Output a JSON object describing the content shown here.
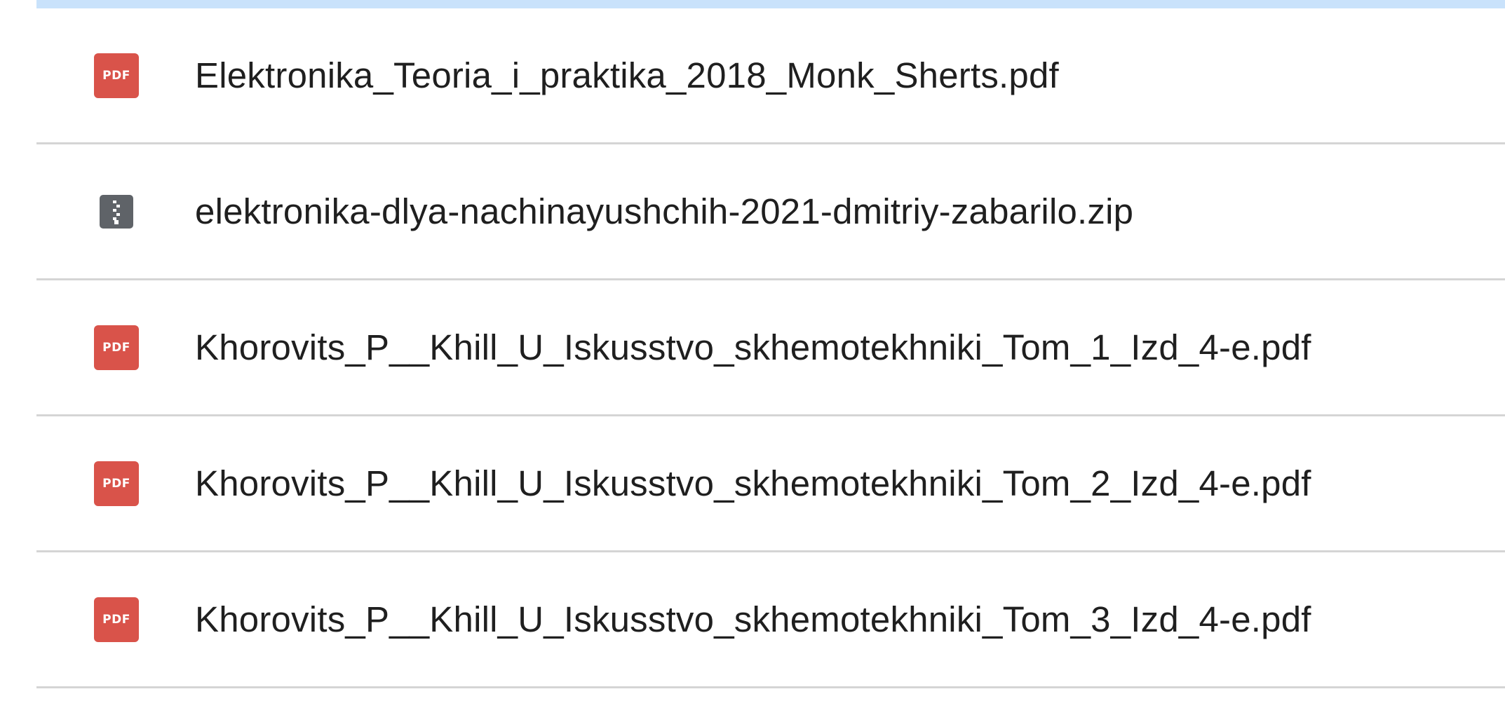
{
  "files": [
    {
      "name": "Elektronika_Teoria_i_praktika_2018_Monk_Sherts.pdf",
      "type_label": "PDF",
      "icon": "pdf-file-icon",
      "icon_color": "#d9534a"
    },
    {
      "name": "elektronika-dlya-nachinayushchih-2021-dmitriy-zabarilo.zip",
      "type_label": "",
      "icon": "zip-archive-icon",
      "icon_color": "#5f6368"
    },
    {
      "name": "Khorovits_P__Khill_U_Iskusstvo_skhemotekhniki_Tom_1_Izd_4-e.pdf",
      "type_label": "PDF",
      "icon": "pdf-file-icon",
      "icon_color": "#d9534a"
    },
    {
      "name": "Khorovits_P__Khill_U_Iskusstvo_skhemotekhniki_Tom_2_Izd_4-e.pdf",
      "type_label": "PDF",
      "icon": "pdf-file-icon",
      "icon_color": "#d9534a"
    },
    {
      "name": "Khorovits_P__Khill_U_Iskusstvo_skhemotekhniki_Tom_3_Izd_4-e.pdf",
      "type_label": "PDF",
      "icon": "pdf-file-icon",
      "icon_color": "#d9534a"
    }
  ],
  "colors": {
    "selected_row_bg": "#c9e2fb",
    "divider": "#d5d5d5",
    "text": "#1f1f1f"
  }
}
